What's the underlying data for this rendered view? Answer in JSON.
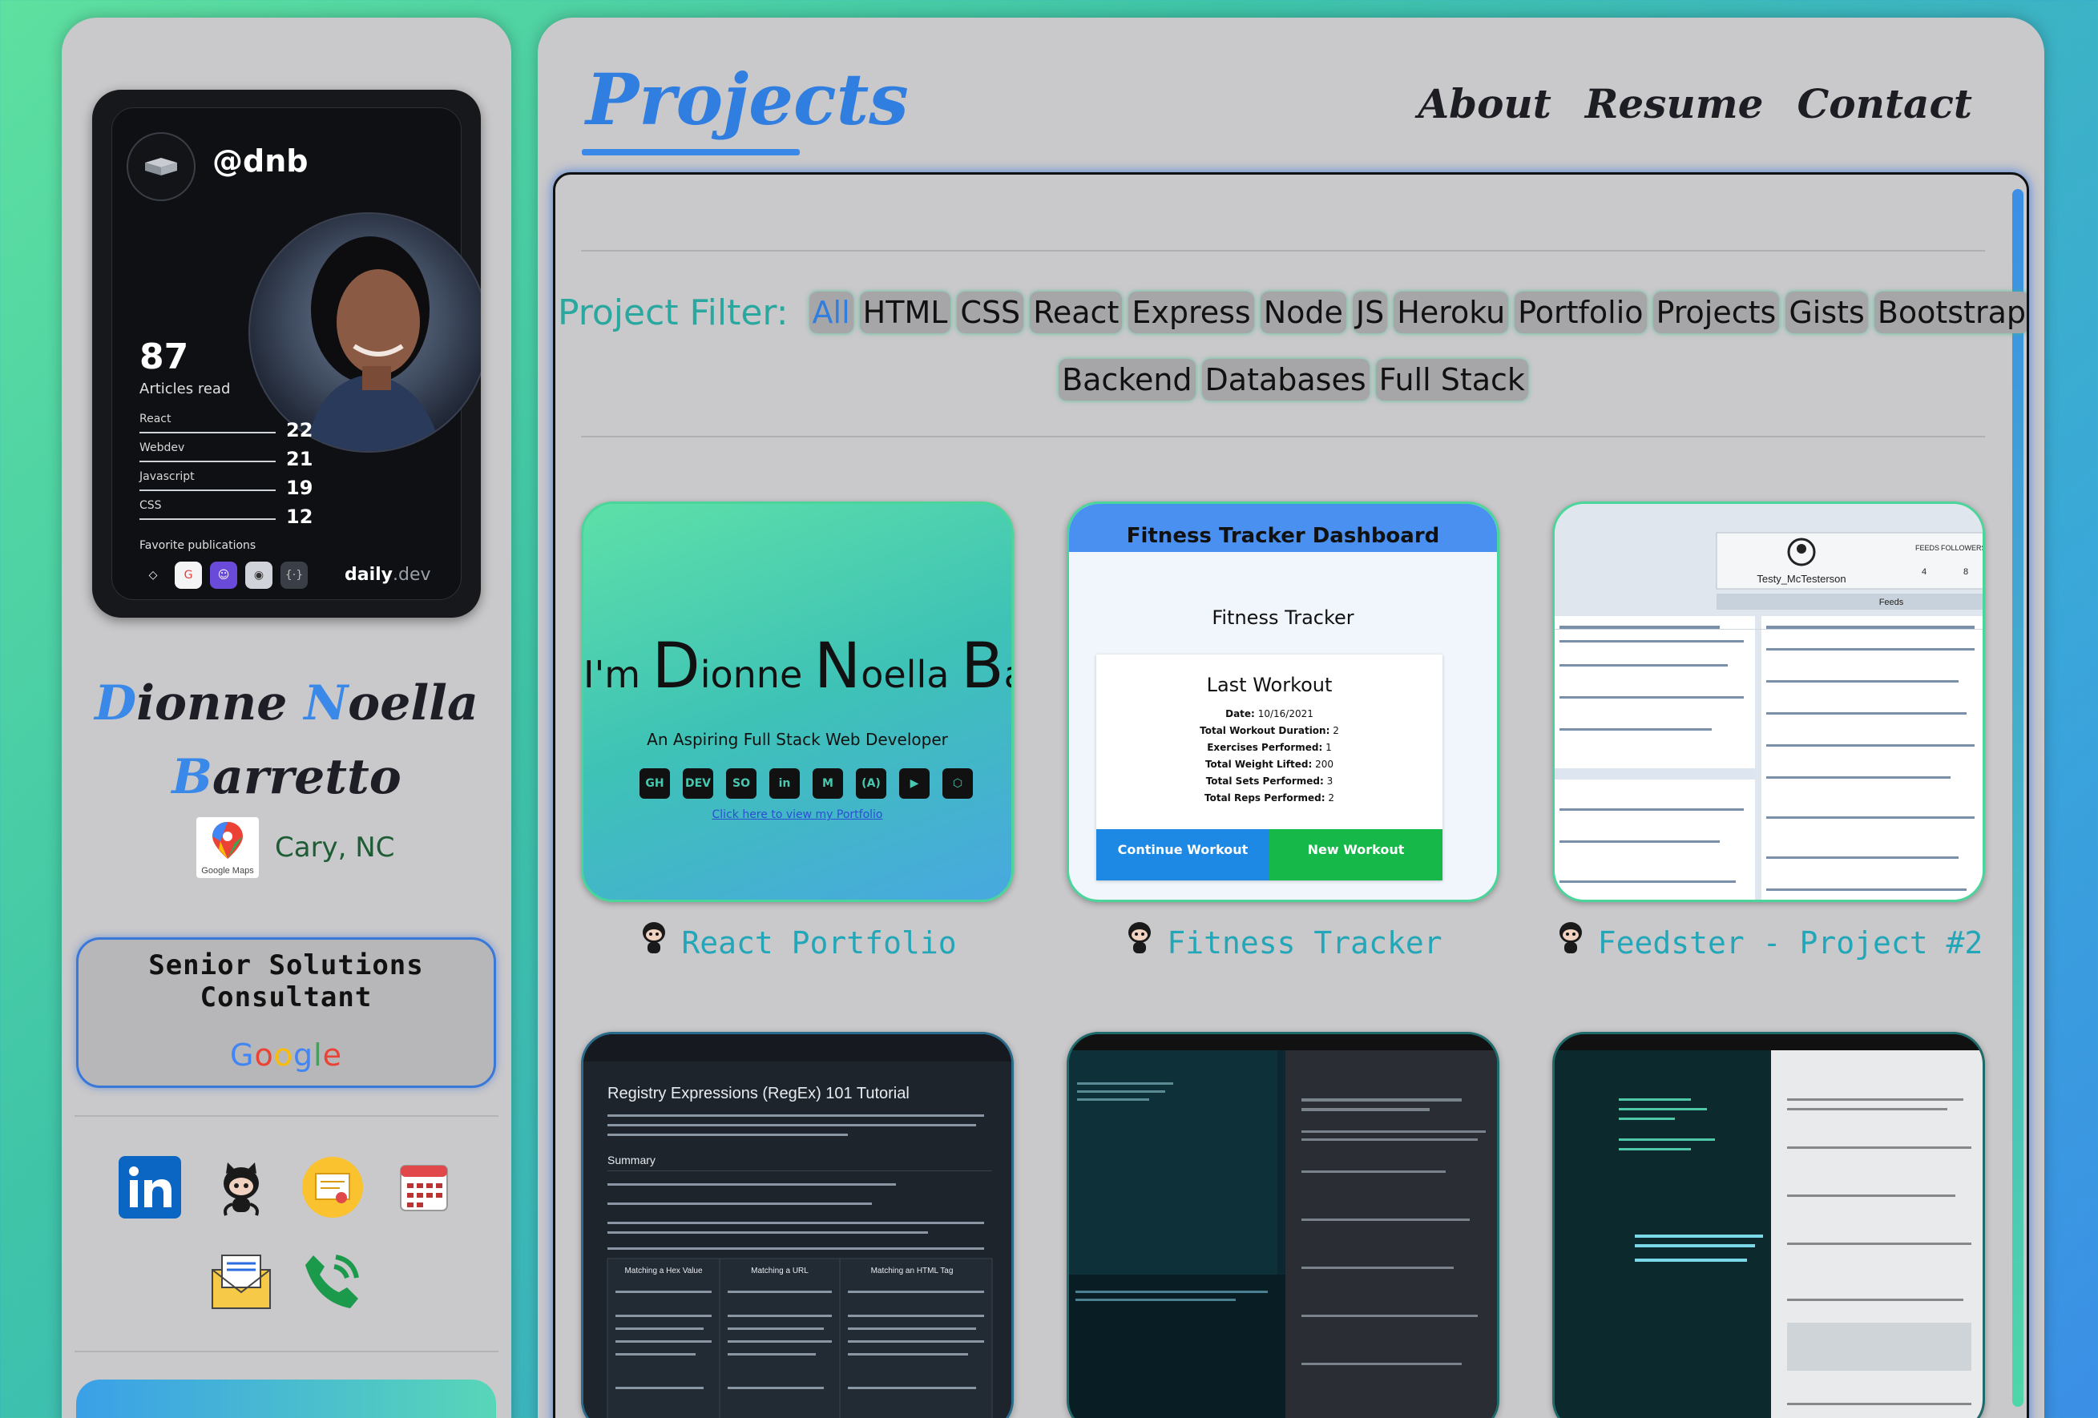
{
  "sidebar": {
    "devcard": {
      "handle": "@dnb",
      "articles_count": "87",
      "articles_label": "Articles read",
      "stats": [
        {
          "label": "React",
          "value": "22"
        },
        {
          "label": "Webdev",
          "value": "21"
        },
        {
          "label": "Javascript",
          "value": "19"
        },
        {
          "label": "CSS",
          "value": "12"
        }
      ],
      "favorite_label": "Favorite publications",
      "brand": "daily",
      "brand_suffix": ".dev"
    },
    "name_line1_first": "D",
    "name_line1_rest1": "ionne ",
    "name_line1_second": "N",
    "name_line1_rest2": "oella",
    "name_line2_first": "B",
    "name_line2_rest": "arretto",
    "maps_label": "Google Maps",
    "location": "Cary, NC",
    "job_title": "Senior Solutions Consultant",
    "job_company": "Google",
    "socials": [
      "linkedin-icon",
      "github-icon",
      "certificate-icon",
      "calendar-icon",
      "email-icon",
      "phone-icon"
    ]
  },
  "main": {
    "title": "Projects",
    "nav": [
      "About",
      "Resume",
      "Contact"
    ],
    "filter_label": "Project Filter:",
    "filters": [
      "All",
      "HTML",
      "CSS",
      "React",
      "Express",
      "Node",
      "JS",
      "Heroku",
      "Portfolio",
      "Projects",
      "Gists",
      "Bootstrap",
      "Backend",
      "Databases",
      "Full Stack"
    ],
    "projects": [
      {
        "title": "React Portfolio",
        "preview": {
          "hello_prefix": "I'm ",
          "hello_D": "D",
          "hello_ionne": "ionne ",
          "hello_N": "N",
          "hello_oella": "oella ",
          "hello_B": "B",
          "hello_a": "a",
          "tagline": "An Aspiring Full Stack Web Developer",
          "link": "Click here to view my Portfolio",
          "icons": [
            "GH",
            "DEV",
            "SO",
            "in",
            "M",
            "(A)",
            "▶",
            "⬡"
          ]
        }
      },
      {
        "title": "Fitness Tracker",
        "preview": {
          "header": "Fitness Tracker Dashboard",
          "subtitle": "Fitness Tracker",
          "panel_title": "Last Workout",
          "rows": [
            {
              "k": "Date:",
              "v": "10/16/2021"
            },
            {
              "k": "Total Workout Duration:",
              "v": "2"
            },
            {
              "k": "Exercises Performed:",
              "v": "1"
            },
            {
              "k": "Total Weight Lifted:",
              "v": "200"
            },
            {
              "k": "Total Sets Performed:",
              "v": "3"
            },
            {
              "k": "Total Reps Performed:",
              "v": "2"
            }
          ],
          "btn_continue": "Continue Workout",
          "btn_new": "New Workout"
        }
      },
      {
        "title": "Feedster - Project #2",
        "preview": {
          "user": "Testy_McTesterson",
          "feeds_label": "FEEDS",
          "followers_label": "FOLLOWERS",
          "feeds_count": "4",
          "followers_count": "8",
          "tab": "Feeds"
        }
      },
      {
        "title": "",
        "preview": {
          "heading": "Registry Expressions (RegEx) 101 Tutorial",
          "summary": "Summary",
          "col1": "Matching a Hex Value",
          "col2": "Matching a URL",
          "col3": "Matching an HTML Tag"
        }
      },
      {
        "title": "",
        "preview": {}
      },
      {
        "title": "",
        "preview": {}
      }
    ]
  },
  "colors": {
    "accent_blue": "#3a88e8",
    "accent_teal": "#23a7b8",
    "panel_gray": "#c9c8ca",
    "fitness_blue": "#1e88e5",
    "fitness_green": "#17b84a"
  }
}
